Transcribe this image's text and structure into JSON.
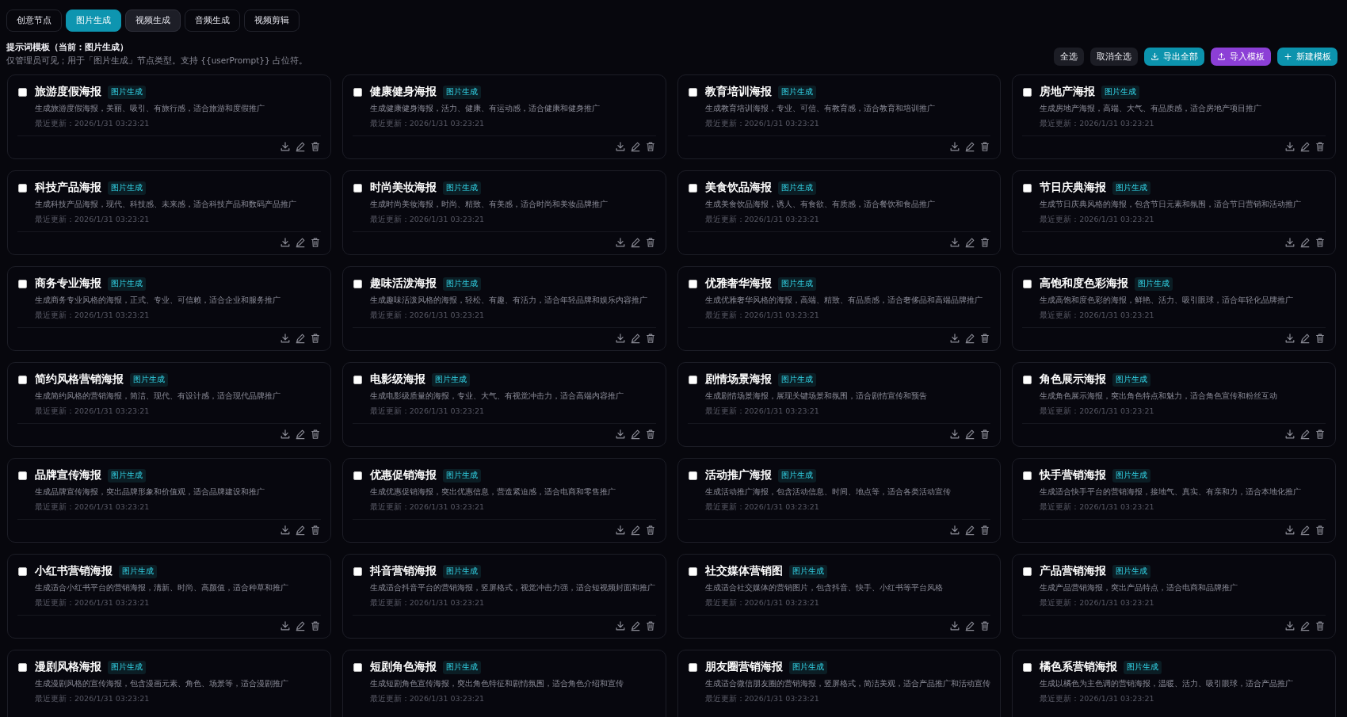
{
  "tabs": [
    {
      "label": "创意节点",
      "selected": false,
      "hovered": false
    },
    {
      "label": "图片生成",
      "selected": true,
      "hovered": false
    },
    {
      "label": "视频生成",
      "selected": false,
      "hovered": true
    },
    {
      "label": "音频生成",
      "selected": false,
      "hovered": false
    },
    {
      "label": "视频剪辑",
      "selected": false,
      "hovered": false
    }
  ],
  "header": {
    "title": "提示词模板（当前：图片生成）",
    "subtitle": "仅管理员可见；用于「图片生成」节点类型。支持 {{userPrompt}} 占位符。"
  },
  "actions": [
    {
      "label": "全选",
      "kind": "plain"
    },
    {
      "label": "取消全选",
      "kind": "plain"
    },
    {
      "label": "导出全部",
      "kind": "export"
    },
    {
      "label": "导入模板",
      "kind": "import"
    },
    {
      "label": "新建模板",
      "kind": "create"
    }
  ],
  "templates": [
    {
      "title": "旅游度假海报",
      "tag": "图片生成",
      "checked": false,
      "description": "生成旅游度假海报，美丽、吸引、有旅行感，适合旅游和度假推广",
      "updated": "最近更新：2026/1/31 03:23:21"
    },
    {
      "title": "健康健身海报",
      "tag": "图片生成",
      "checked": false,
      "description": "生成健康健身海报，活力、健康、有运动感，适合健康和健身推广",
      "updated": "最近更新：2026/1/31 03:23:21"
    },
    {
      "title": "教育培训海报",
      "tag": "图片生成",
      "checked": false,
      "description": "生成教育培训海报，专业、可信、有教育感，适合教育和培训推广",
      "updated": "最近更新：2026/1/31 03:23:21"
    },
    {
      "title": "房地产海报",
      "tag": "图片生成",
      "checked": false,
      "description": "生成房地产海报，高端、大气、有品质感，适合房地产项目推广",
      "updated": "最近更新：2026/1/31 03:23:21"
    },
    {
      "title": "科技产品海报",
      "tag": "图片生成",
      "checked": false,
      "description": "生成科技产品海报，现代、科技感、未来感，适合科技产品和数码产品推广",
      "updated": "最近更新：2026/1/31 03:23:21"
    },
    {
      "title": "时尚美妆海报",
      "tag": "图片生成",
      "checked": false,
      "description": "生成时尚美妆海报，时尚、精致、有美感，适合时尚和美妆品牌推广",
      "updated": "最近更新：2026/1/31 03:23:21"
    },
    {
      "title": "美食饮品海报",
      "tag": "图片生成",
      "checked": false,
      "description": "生成美食饮品海报，诱人、有食欲、有质感，适合餐饮和食品推广",
      "updated": "最近更新：2026/1/31 03:23:21"
    },
    {
      "title": "节日庆典海报",
      "tag": "图片生成",
      "checked": false,
      "description": "生成节日庆典风格的海报，包含节日元素和氛围，适合节日营销和活动推广",
      "updated": "最近更新：2026/1/31 03:23:21"
    },
    {
      "title": "商务专业海报",
      "tag": "图片生成",
      "checked": false,
      "description": "生成商务专业风格的海报，正式、专业、可信赖，适合企业和服务推广",
      "updated": "最近更新：2026/1/31 03:23:21"
    },
    {
      "title": "趣味活泼海报",
      "tag": "图片生成",
      "checked": false,
      "description": "生成趣味活泼风格的海报，轻松、有趣、有活力，适合年轻品牌和娱乐内容推广",
      "updated": "最近更新：2026/1/31 03:23:21"
    },
    {
      "title": "优雅奢华海报",
      "tag": "图片生成",
      "checked": false,
      "description": "生成优雅奢华风格的海报，高端、精致、有品质感，适合奢侈品和高端品牌推广",
      "updated": "最近更新：2026/1/31 03:23:21"
    },
    {
      "title": "高饱和度色彩海报",
      "tag": "图片生成",
      "checked": false,
      "description": "生成高饱和度色彩的海报，鲜艳、活力、吸引眼球，适合年轻化品牌推广",
      "updated": "最近更新：2026/1/31 03:23:21"
    },
    {
      "title": "简约风格营销海报",
      "tag": "图片生成",
      "checked": false,
      "description": "生成简约风格的营销海报，简洁、现代、有设计感，适合现代品牌推广",
      "updated": "最近更新：2026/1/31 03:23:21"
    },
    {
      "title": "电影级海报",
      "tag": "图片生成",
      "checked": false,
      "description": "生成电影级质量的海报，专业、大气、有视觉冲击力，适合高端内容推广",
      "updated": "最近更新：2026/1/31 03:23:21"
    },
    {
      "title": "剧情场景海报",
      "tag": "图片生成",
      "checked": false,
      "description": "生成剧情场景海报，展现关键场景和氛围，适合剧情宣传和预告",
      "updated": "最近更新：2026/1/31 03:23:21"
    },
    {
      "title": "角色展示海报",
      "tag": "图片生成",
      "checked": false,
      "description": "生成角色展示海报，突出角色特点和魅力，适合角色宣传和粉丝互动",
      "updated": "最近更新：2026/1/31 03:23:21"
    },
    {
      "title": "品牌宣传海报",
      "tag": "图片生成",
      "checked": false,
      "description": "生成品牌宣传海报，突出品牌形象和价值观，适合品牌建设和推广",
      "updated": "最近更新：2026/1/31 03:23:21"
    },
    {
      "title": "优惠促销海报",
      "tag": "图片生成",
      "checked": false,
      "description": "生成优惠促销海报，突出优惠信息，营造紧迫感，适合电商和零售推广",
      "updated": "最近更新：2026/1/31 03:23:21"
    },
    {
      "title": "活动推广海报",
      "tag": "图片生成",
      "checked": false,
      "description": "生成活动推广海报，包含活动信息、时间、地点等，适合各类活动宣传",
      "updated": "最近更新：2026/1/31 03:23:21"
    },
    {
      "title": "快手营销海报",
      "tag": "图片生成",
      "checked": false,
      "description": "生成适合快手平台的营销海报，接地气、真实、有亲和力，适合本地化推广",
      "updated": "最近更新：2026/1/31 03:23:21"
    },
    {
      "title": "小红书营销海报",
      "tag": "图片生成",
      "checked": false,
      "description": "生成适合小红书平台的营销海报，清新、时尚、高颜值，适合种草和推广",
      "updated": "最近更新：2026/1/31 03:23:21"
    },
    {
      "title": "抖音营销海报",
      "tag": "图片生成",
      "checked": false,
      "description": "生成适合抖音平台的营销海报，竖屏格式，视觉冲击力强，适合短视频封面和推广",
      "updated": "最近更新：2026/1/31 03:23:21"
    },
    {
      "title": "社交媒体营销图",
      "tag": "图片生成",
      "checked": false,
      "description": "生成适合社交媒体的营销图片，包含抖音、快手、小红书等平台风格",
      "updated": "最近更新：2026/1/31 03:23:21"
    },
    {
      "title": "产品营销海报",
      "tag": "图片生成",
      "checked": false,
      "description": "生成产品营销海报，突出产品特点，适合电商和品牌推广",
      "updated": "最近更新：2026/1/31 03:23:21"
    },
    {
      "title": "漫剧风格海报",
      "tag": "图片生成",
      "checked": false,
      "description": "生成漫剧风格的宣传海报，包含漫画元素、角色、场景等，适合漫剧推广",
      "updated": "最近更新：2026/1/31 03:23:21"
    },
    {
      "title": "短剧角色海报",
      "tag": "图片生成",
      "checked": false,
      "description": "生成短剧角色宣传海报，突出角色特征和剧情氛围，适合角色介绍和宣传",
      "updated": "最近更新：2026/1/31 03:23:21"
    },
    {
      "title": "朋友圈营销海报",
      "tag": "图片生成",
      "checked": false,
      "description": "生成适合微信朋友圈的营销海报，竖屏格式，简洁美观，适合产品推广和活动宣传",
      "updated": "最近更新：2026/1/31 03:23:21"
    },
    {
      "title": "橘色系营销海报",
      "tag": "图片生成",
      "checked": false,
      "description": "生成以橘色为主色调的营销海报，温暖、活力、吸引眼球，适合产品推广",
      "updated": "最近更新：2026/1/31 03:23:21"
    }
  ]
}
